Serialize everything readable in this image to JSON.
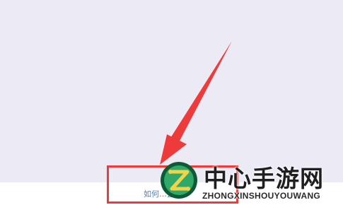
{
  "help_link": {
    "label": "如何…置"
  },
  "annotation": {
    "color": "#ee3a3a"
  },
  "watermark": {
    "title": "中心手游网",
    "subtitle": "ZHONGXINSHOUYOUWANG",
    "logo_letter": "Z",
    "logo_colors": {
      "outer": "#0c5a36",
      "inner": "#2fa868",
      "letter": "#f0d34a"
    }
  }
}
